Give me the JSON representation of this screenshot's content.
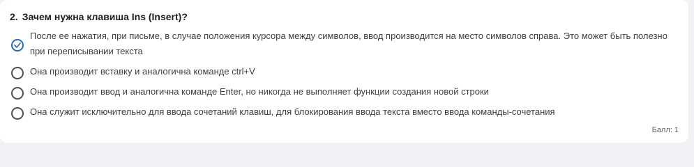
{
  "question": {
    "number": "2.",
    "text": "Зачем нужна клавиша Ins (Insert)?"
  },
  "options": [
    {
      "label": "После ее нажатия, при письме, в случае положения курсора между символов, ввод производится на место символов справа. Это может быть полезно при переписывании текста",
      "selected": true
    },
    {
      "label": "Она производит вставку и аналогична команде ctrl+V",
      "selected": false
    },
    {
      "label": "Она производит ввод и аналогична команде Enter, но никогда не выполняет функции создания новой строки",
      "selected": false
    },
    {
      "label": "Она служит исключительно для ввода сочетаний клавиш, для блокирования ввода текста вместо ввода команды-сочетания",
      "selected": false
    }
  ],
  "score_label": "Балл: 1",
  "colors": {
    "selected_accent": "#2b6cb0",
    "radio_border": "#4d5156",
    "card_background": "#ffffff",
    "page_background": "#f0f2f5"
  }
}
